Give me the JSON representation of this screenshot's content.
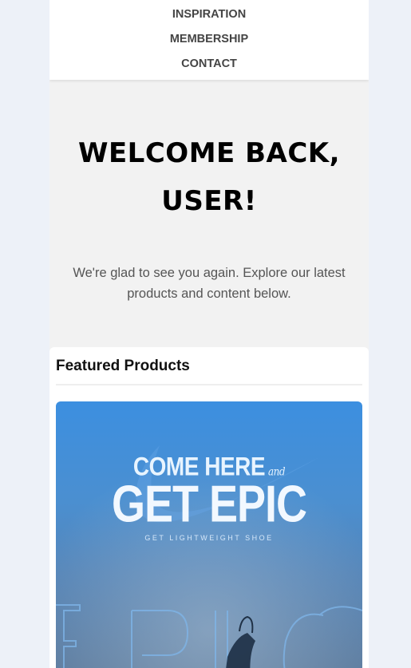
{
  "nav": {
    "items": [
      {
        "label": "INSPIRATION"
      },
      {
        "label": "MEMBERSHIP"
      },
      {
        "label": "CONTACT"
      }
    ]
  },
  "hero": {
    "title": "WELCOME BACK, USER!",
    "subtitle": "We're glad to see you again. Explore our latest products and content below."
  },
  "featured": {
    "heading": "Featured Products",
    "product": {
      "line1": "COME HERE",
      "line1_suffix": "and",
      "headline": "GET EPIC",
      "tagline": "GET LIGHTWEIGHT SHOE",
      "background_text": "EPIC"
    }
  },
  "colors": {
    "page_bg": "#edf1f8",
    "hero_bg": "#f2f2f2",
    "card_blue": "#3c8fe0"
  }
}
